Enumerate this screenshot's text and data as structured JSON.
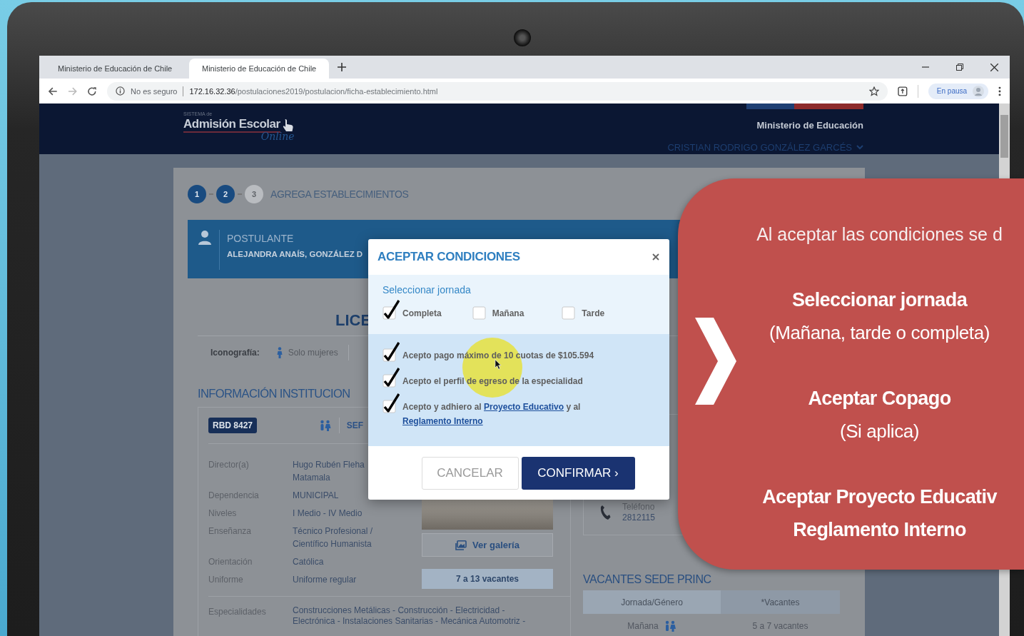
{
  "browser": {
    "tabs": [
      {
        "title": "Ministerio de Educación de Chile",
        "selected": false
      },
      {
        "title": "Ministerio de Educación de Chile",
        "selected": true
      }
    ],
    "security": "No es seguro",
    "url_host": "172.16.32.36",
    "url_path": "/postulaciones2019/postulacion/ficha-establecimiento.html",
    "profile": "En pausa"
  },
  "header": {
    "logo_small": "SISTEMA de",
    "logo": "Admisión Escolar",
    "logo_script": "Online",
    "ministry": "Ministerio de Educación",
    "user": "CRISTIAN RODRIGO GONZÁLEZ GARCÉS"
  },
  "steps": [
    {
      "label": "1",
      "done": true
    },
    {
      "label": "2",
      "done": true
    },
    {
      "label": "3",
      "done": false
    }
  ],
  "steps_title": "AGREGA ESTABLECIMIENTOS",
  "applicant": {
    "label": "POSTULANTE",
    "name": "ALEJANDRA ANAÍS, GONZÁLEZ D"
  },
  "school_title": "LICE",
  "iconography": {
    "label": "Iconografía:",
    "items": [
      "Solo mujeres"
    ]
  },
  "info": {
    "heading": "INFORMACIÓN INSTITUCION",
    "rbd": "RBD 8427",
    "type_partial": "SEF",
    "rows": [
      {
        "label": "Director(a)",
        "value": "Hugo Rubén Fleha\nMatamala"
      },
      {
        "label": "Dependencia",
        "value": "MUNICIPAL"
      },
      {
        "label": "Niveles",
        "value": "I Medio - IV Medio"
      },
      {
        "label": "Enseñanza",
        "value": "Técnico Profesional /\nCientífico Humanista"
      },
      {
        "label": "Orientación",
        "value": "Católica"
      },
      {
        "label": "Uniforme",
        "value": "Uniforme regular"
      }
    ],
    "specialties_label": "Especialidades",
    "specialties": "Construcciones Metálicas - Construcción - Electricidad -\nElectrónica - Instalaciones Sanitarias - Mecánica Automotriz -",
    "gallery_button": "Ver galería",
    "vacancies": "7 a 13 vacantes"
  },
  "contact": {
    "phone_label": "Teléfono",
    "phone": "2812115"
  },
  "vacancies": {
    "heading": "VACANTES SEDE PRINC",
    "columns": [
      "Jornada/Género",
      "*Vacantes"
    ],
    "rows": [
      {
        "jornada": "Mañana",
        "vacantes": "5 a 7 vacantes"
      }
    ]
  },
  "modal": {
    "title": "ACEPTAR CONDICIONES",
    "section_label": "Seleccionar jornada",
    "shifts": [
      {
        "label": "Completa",
        "checked": true
      },
      {
        "label": "Mañana",
        "checked": false
      },
      {
        "label": "Tarde",
        "checked": false
      }
    ],
    "conditions": [
      {
        "checked": true,
        "parts": [
          {
            "text": "Acepto pago máximo de 10 cuotas de $105.594",
            "link": false
          }
        ]
      },
      {
        "checked": true,
        "parts": [
          {
            "text": "Acepto el perfil de egreso de la especialidad",
            "link": false
          }
        ]
      },
      {
        "checked": true,
        "parts": [
          {
            "text": "Acepto y adhiero al ",
            "link": false
          },
          {
            "text": "Proyecto Educativo",
            "link": true
          },
          {
            "text": " y al ",
            "link": false
          },
          {
            "text": "Reglamento Interno",
            "link": true
          }
        ]
      }
    ],
    "cancel": "CANCELAR",
    "confirm": "CONFIRMAR ›"
  },
  "callout": {
    "lines": [
      {
        "kind": "intro",
        "text": "Al aceptar las condiciones se d"
      },
      {
        "kind": "title",
        "text": "Seleccionar jornada"
      },
      {
        "kind": "note",
        "text": "(Mañana, tarde o completa)"
      },
      {
        "kind": "title",
        "text": "Aceptar Copago"
      },
      {
        "kind": "note",
        "text": "(Si aplica)"
      },
      {
        "kind": "title",
        "text": "Aceptar Proyecto Educativ\nReglamento Interno"
      }
    ]
  }
}
